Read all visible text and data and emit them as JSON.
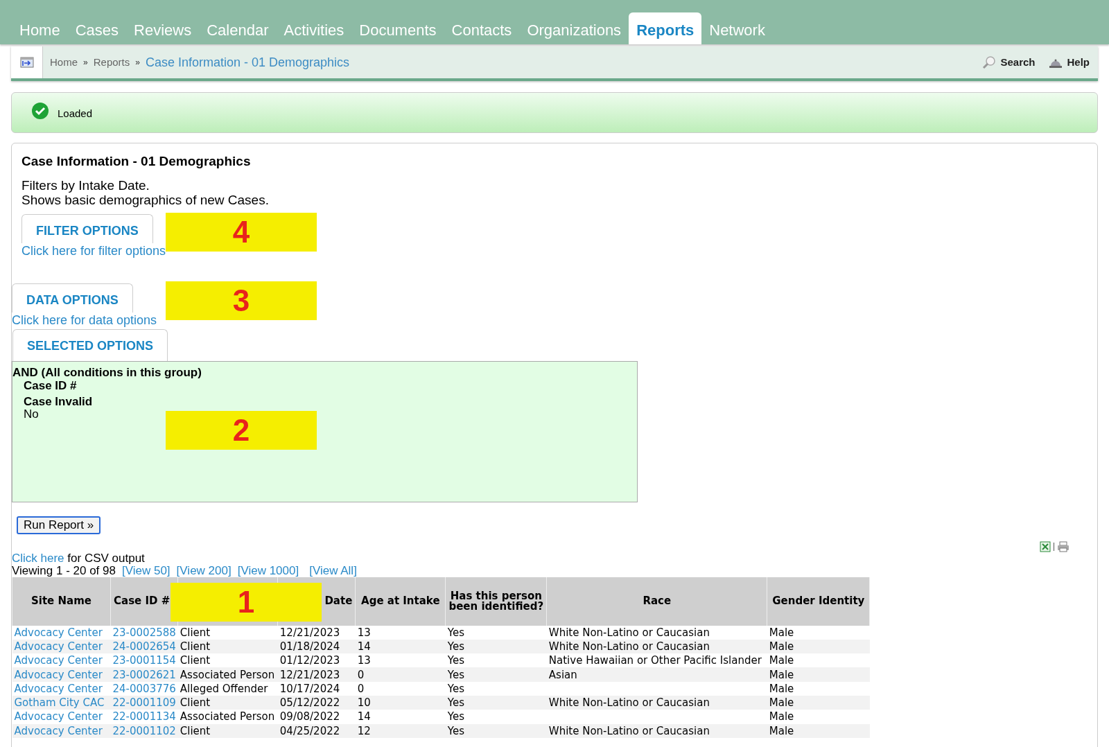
{
  "nav_tabs": [
    {
      "label": "Home",
      "selected": false
    },
    {
      "label": "Cases",
      "selected": false
    },
    {
      "label": "Reviews",
      "selected": false
    },
    {
      "label": "Calendar",
      "selected": false
    },
    {
      "label": "Activities",
      "selected": false
    },
    {
      "label": "Documents",
      "selected": false
    },
    {
      "label": "Contacts",
      "selected": false
    },
    {
      "label": "Organizations",
      "selected": false
    },
    {
      "label": "Reports",
      "selected": true
    },
    {
      "label": "Network",
      "selected": false
    }
  ],
  "breadcrumb": {
    "items": [
      "Home",
      "Reports"
    ],
    "separator": "»",
    "current": "Case Information - 01 Demographics"
  },
  "toolbar": {
    "search": "Search",
    "help": "Help"
  },
  "status": {
    "message": "Loaded"
  },
  "report": {
    "title": "Case Information - 01 Demographics",
    "description": [
      "Filters by Intake Date.",
      "Shows basic demographics of new Cases."
    ],
    "filter_options": {
      "tab": "FILTER OPTIONS",
      "link": "Click here for filter options"
    },
    "data_options": {
      "tab": "DATA OPTIONS",
      "link": "Click here for data options"
    },
    "selected_options": {
      "tab": "SELECTED OPTIONS",
      "group": "AND (All conditions in this group)",
      "conditions": [
        {
          "field": "Case ID #"
        },
        {
          "field": "Case Invalid",
          "value": "No"
        }
      ]
    },
    "run_button": "Run Report »",
    "csv": {
      "link": "Click here",
      "text": "for CSV output"
    },
    "viewing": "Viewing 1 - 20 of 98",
    "view_links": [
      "[View 50]",
      "[View 200]",
      "[View 1000]",
      "[View All]"
    ]
  },
  "table": {
    "columns": [
      "Site Name",
      "Case ID #",
      null,
      "Date",
      "Age at Intake",
      "Has this person been identified?",
      "Race",
      "Gender Identity"
    ],
    "rows": [
      [
        "Advocacy Center",
        "23-0002588",
        "Client",
        "12/21/2023",
        "13",
        "Yes",
        "White Non-Latino or Caucasian",
        "Male"
      ],
      [
        "Advocacy Center",
        "24-0002654",
        "Client",
        "01/18/2024",
        "14",
        "Yes",
        "White Non-Latino or Caucasian",
        "Male"
      ],
      [
        "Advocacy Center",
        "23-0001154",
        "Client",
        "01/12/2023",
        "13",
        "Yes",
        "Native Hawaiian or Other Pacific Islander",
        "Male"
      ],
      [
        "Advocacy Center",
        "23-0002621",
        "Associated Person",
        "12/21/2023",
        "0",
        "Yes",
        "Asian",
        "Male"
      ],
      [
        "Advocacy Center",
        "24-0003776",
        "Alleged Offender",
        "10/17/2024",
        "0",
        "Yes",
        null,
        "Male"
      ],
      [
        "Gotham City CAC",
        "22-0001109",
        "Client",
        "05/12/2022",
        "10",
        "Yes",
        "White Non-Latino or Caucasian",
        "Male"
      ],
      [
        "Advocacy Center",
        "22-0001134",
        "Associated Person",
        "09/08/2022",
        "14",
        "Yes",
        null,
        "Male"
      ],
      [
        "Advocacy Center",
        "22-0001102",
        "Client",
        "04/25/2022",
        "12",
        "Yes",
        "White Non-Latino or Caucasian",
        "Male"
      ]
    ]
  },
  "annotations": [
    {
      "label": "4"
    },
    {
      "label": "3"
    },
    {
      "label": "2"
    },
    {
      "label": "1"
    }
  ]
}
